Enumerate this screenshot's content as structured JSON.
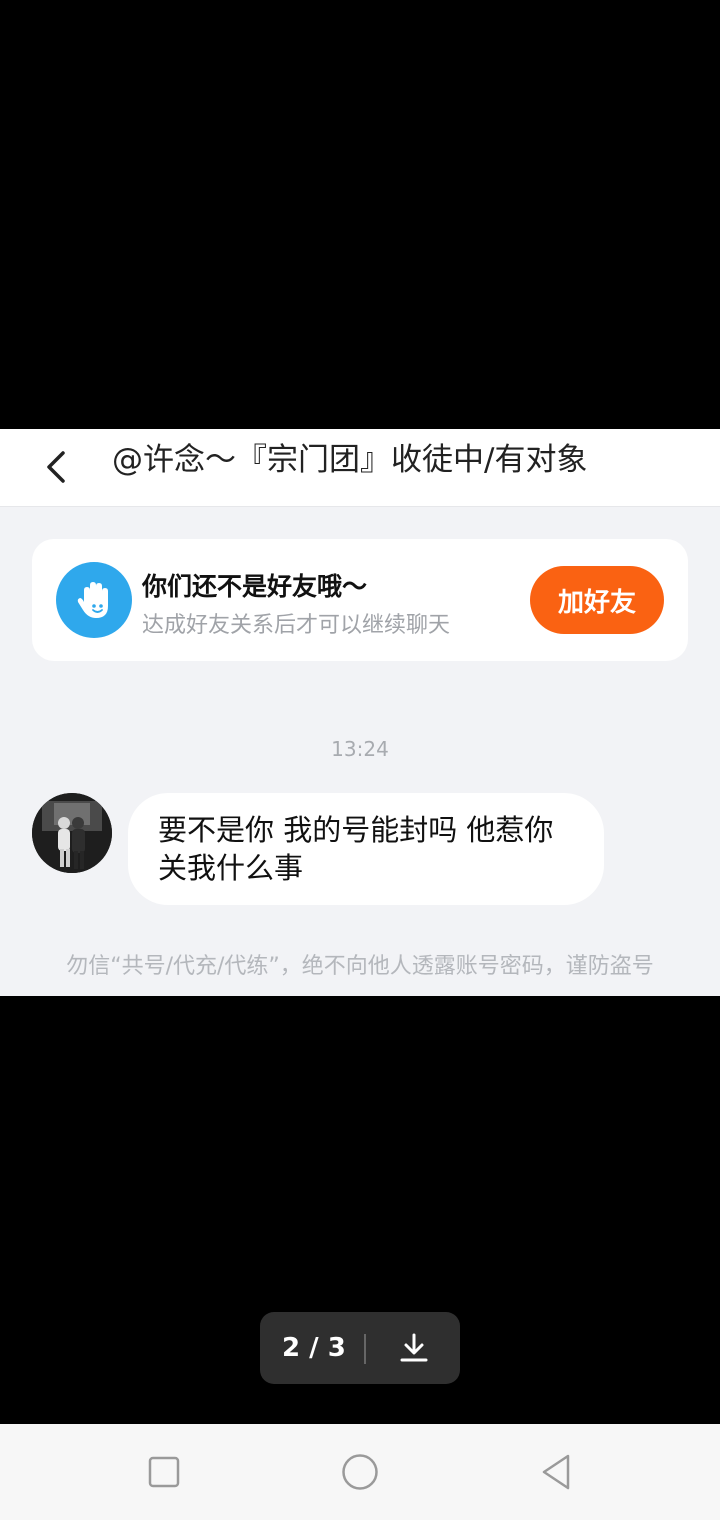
{
  "header": {
    "back_icon": "chevron-left-icon",
    "title": "@许念～『宗门团』收徒中/有对象"
  },
  "friend_card": {
    "icon": "waving-hand-icon",
    "title": "你们还不是好友哦～",
    "subtitle": "达成好友关系后才可以继续聊天",
    "button_label": "加好友",
    "button_color": "#fa6212",
    "icon_color": "#2fa8ec"
  },
  "chat": {
    "timestamp": "13:24",
    "messages": [
      {
        "text": "要不是你 我的号能封吗 他惹你关我什么事"
      }
    ]
  },
  "warning": {
    "text": "勿信“共号/代充/代练”，绝不向他人透露账号密码，谨防盗号"
  },
  "viewer": {
    "page_indicator": "2 / 3",
    "download_icon": "download-icon"
  },
  "system_nav": {
    "recent_icon": "square-icon",
    "home_icon": "circle-icon",
    "back_icon": "triangle-back-icon"
  }
}
